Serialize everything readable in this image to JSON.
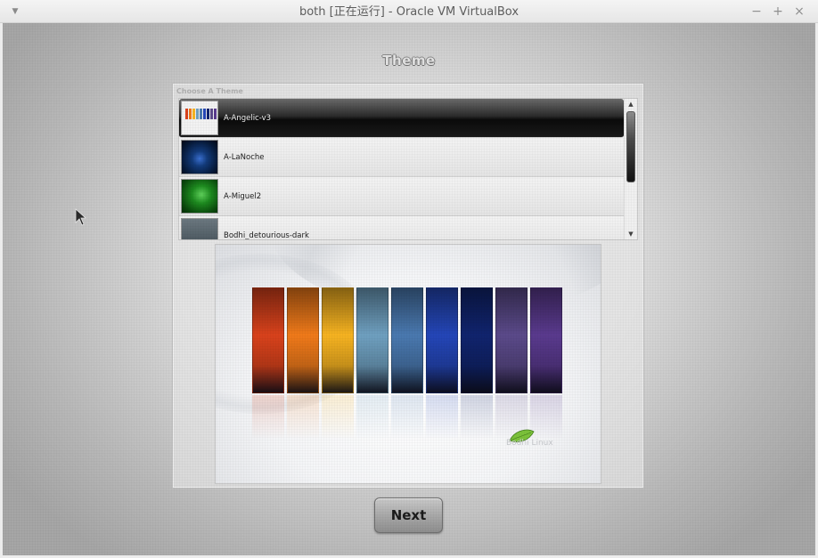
{
  "window": {
    "title": "both [正在运行] - Oracle VM VirtualBox",
    "menu_icon": "chevron-down-icon",
    "controls": {
      "minimize": "−",
      "maximize": "+",
      "close": "×"
    }
  },
  "page": {
    "heading": "Theme",
    "group_label": "Choose A Theme"
  },
  "themes": [
    {
      "name": "A-Angelic-v3",
      "selected": true
    },
    {
      "name": "A-LaNoche",
      "selected": false
    },
    {
      "name": "A-Miguel2",
      "selected": false
    },
    {
      "name": "Bodhi_detourious-dark",
      "selected": false
    }
  ],
  "preview": {
    "watermark": "Bodhi Linux",
    "panel_colors": [
      "#d9421c",
      "#f07a1a",
      "#f6b321",
      "#6fa0c0",
      "#4a79b0",
      "#2446b8",
      "#10246e",
      "#5b4a8a",
      "#5a3a8e"
    ]
  },
  "next_button": {
    "label": "Next"
  },
  "colors": {
    "accent_selected": "#1a1a1a",
    "list_bg": "#f7f7f7"
  }
}
